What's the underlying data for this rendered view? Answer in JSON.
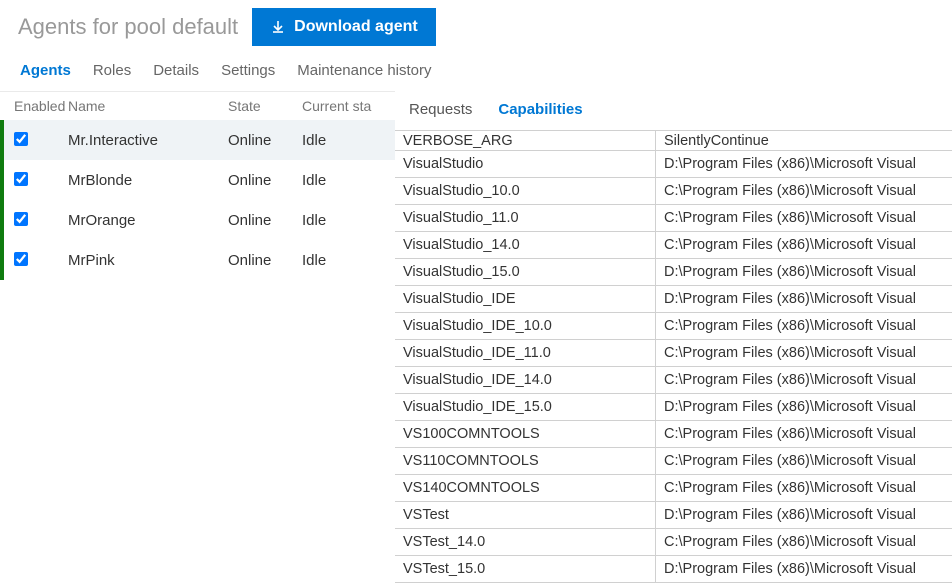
{
  "header": {
    "title": "Agents for pool default",
    "download_label": "Download agent"
  },
  "mainTabs": {
    "items": [
      {
        "label": "Agents",
        "active": true
      },
      {
        "label": "Roles"
      },
      {
        "label": "Details"
      },
      {
        "label": "Settings"
      },
      {
        "label": "Maintenance history"
      }
    ]
  },
  "agentsTable": {
    "columns": {
      "enabled": "Enabled",
      "name": "Name",
      "state": "State",
      "current": "Current sta"
    },
    "rows": [
      {
        "name": "Mr.Interactive",
        "state": "Online",
        "current": "Idle",
        "enabled": true,
        "selected": true
      },
      {
        "name": "MrBlonde",
        "state": "Online",
        "current": "Idle",
        "enabled": true
      },
      {
        "name": "MrOrange",
        "state": "Online",
        "current": "Idle",
        "enabled": true
      },
      {
        "name": "MrPink",
        "state": "Online",
        "current": "Idle",
        "enabled": true
      }
    ]
  },
  "subTabs": {
    "items": [
      {
        "label": "Requests"
      },
      {
        "label": "Capabilities",
        "active": true
      }
    ]
  },
  "capabilities": [
    {
      "key": "VERBOSE_ARG",
      "value": "SilentlyContinue"
    },
    {
      "key": "VisualStudio",
      "value": "D:\\Program Files (x86)\\Microsoft Visual "
    },
    {
      "key": "VisualStudio_10.0",
      "value": "C:\\Program Files (x86)\\Microsoft Visual "
    },
    {
      "key": "VisualStudio_11.0",
      "value": "C:\\Program Files (x86)\\Microsoft Visual "
    },
    {
      "key": "VisualStudio_14.0",
      "value": "C:\\Program Files (x86)\\Microsoft Visual "
    },
    {
      "key": "VisualStudio_15.0",
      "value": "D:\\Program Files (x86)\\Microsoft Visual "
    },
    {
      "key": "VisualStudio_IDE",
      "value": "D:\\Program Files (x86)\\Microsoft Visual "
    },
    {
      "key": "VisualStudio_IDE_10.0",
      "value": "C:\\Program Files (x86)\\Microsoft Visual "
    },
    {
      "key": "VisualStudio_IDE_11.0",
      "value": "C:\\Program Files (x86)\\Microsoft Visual "
    },
    {
      "key": "VisualStudio_IDE_14.0",
      "value": "C:\\Program Files (x86)\\Microsoft Visual "
    },
    {
      "key": "VisualStudio_IDE_15.0",
      "value": "D:\\Program Files (x86)\\Microsoft Visual "
    },
    {
      "key": "VS100COMNTOOLS",
      "value": "C:\\Program Files (x86)\\Microsoft Visual "
    },
    {
      "key": "VS110COMNTOOLS",
      "value": "C:\\Program Files (x86)\\Microsoft Visual "
    },
    {
      "key": "VS140COMNTOOLS",
      "value": "C:\\Program Files (x86)\\Microsoft Visual "
    },
    {
      "key": "VSTest",
      "value": "D:\\Program Files (x86)\\Microsoft Visual "
    },
    {
      "key": "VSTest_14.0",
      "value": "C:\\Program Files (x86)\\Microsoft Visual "
    },
    {
      "key": "VSTest_15.0",
      "value": "D:\\Program Files (x86)\\Microsoft Visual "
    }
  ]
}
